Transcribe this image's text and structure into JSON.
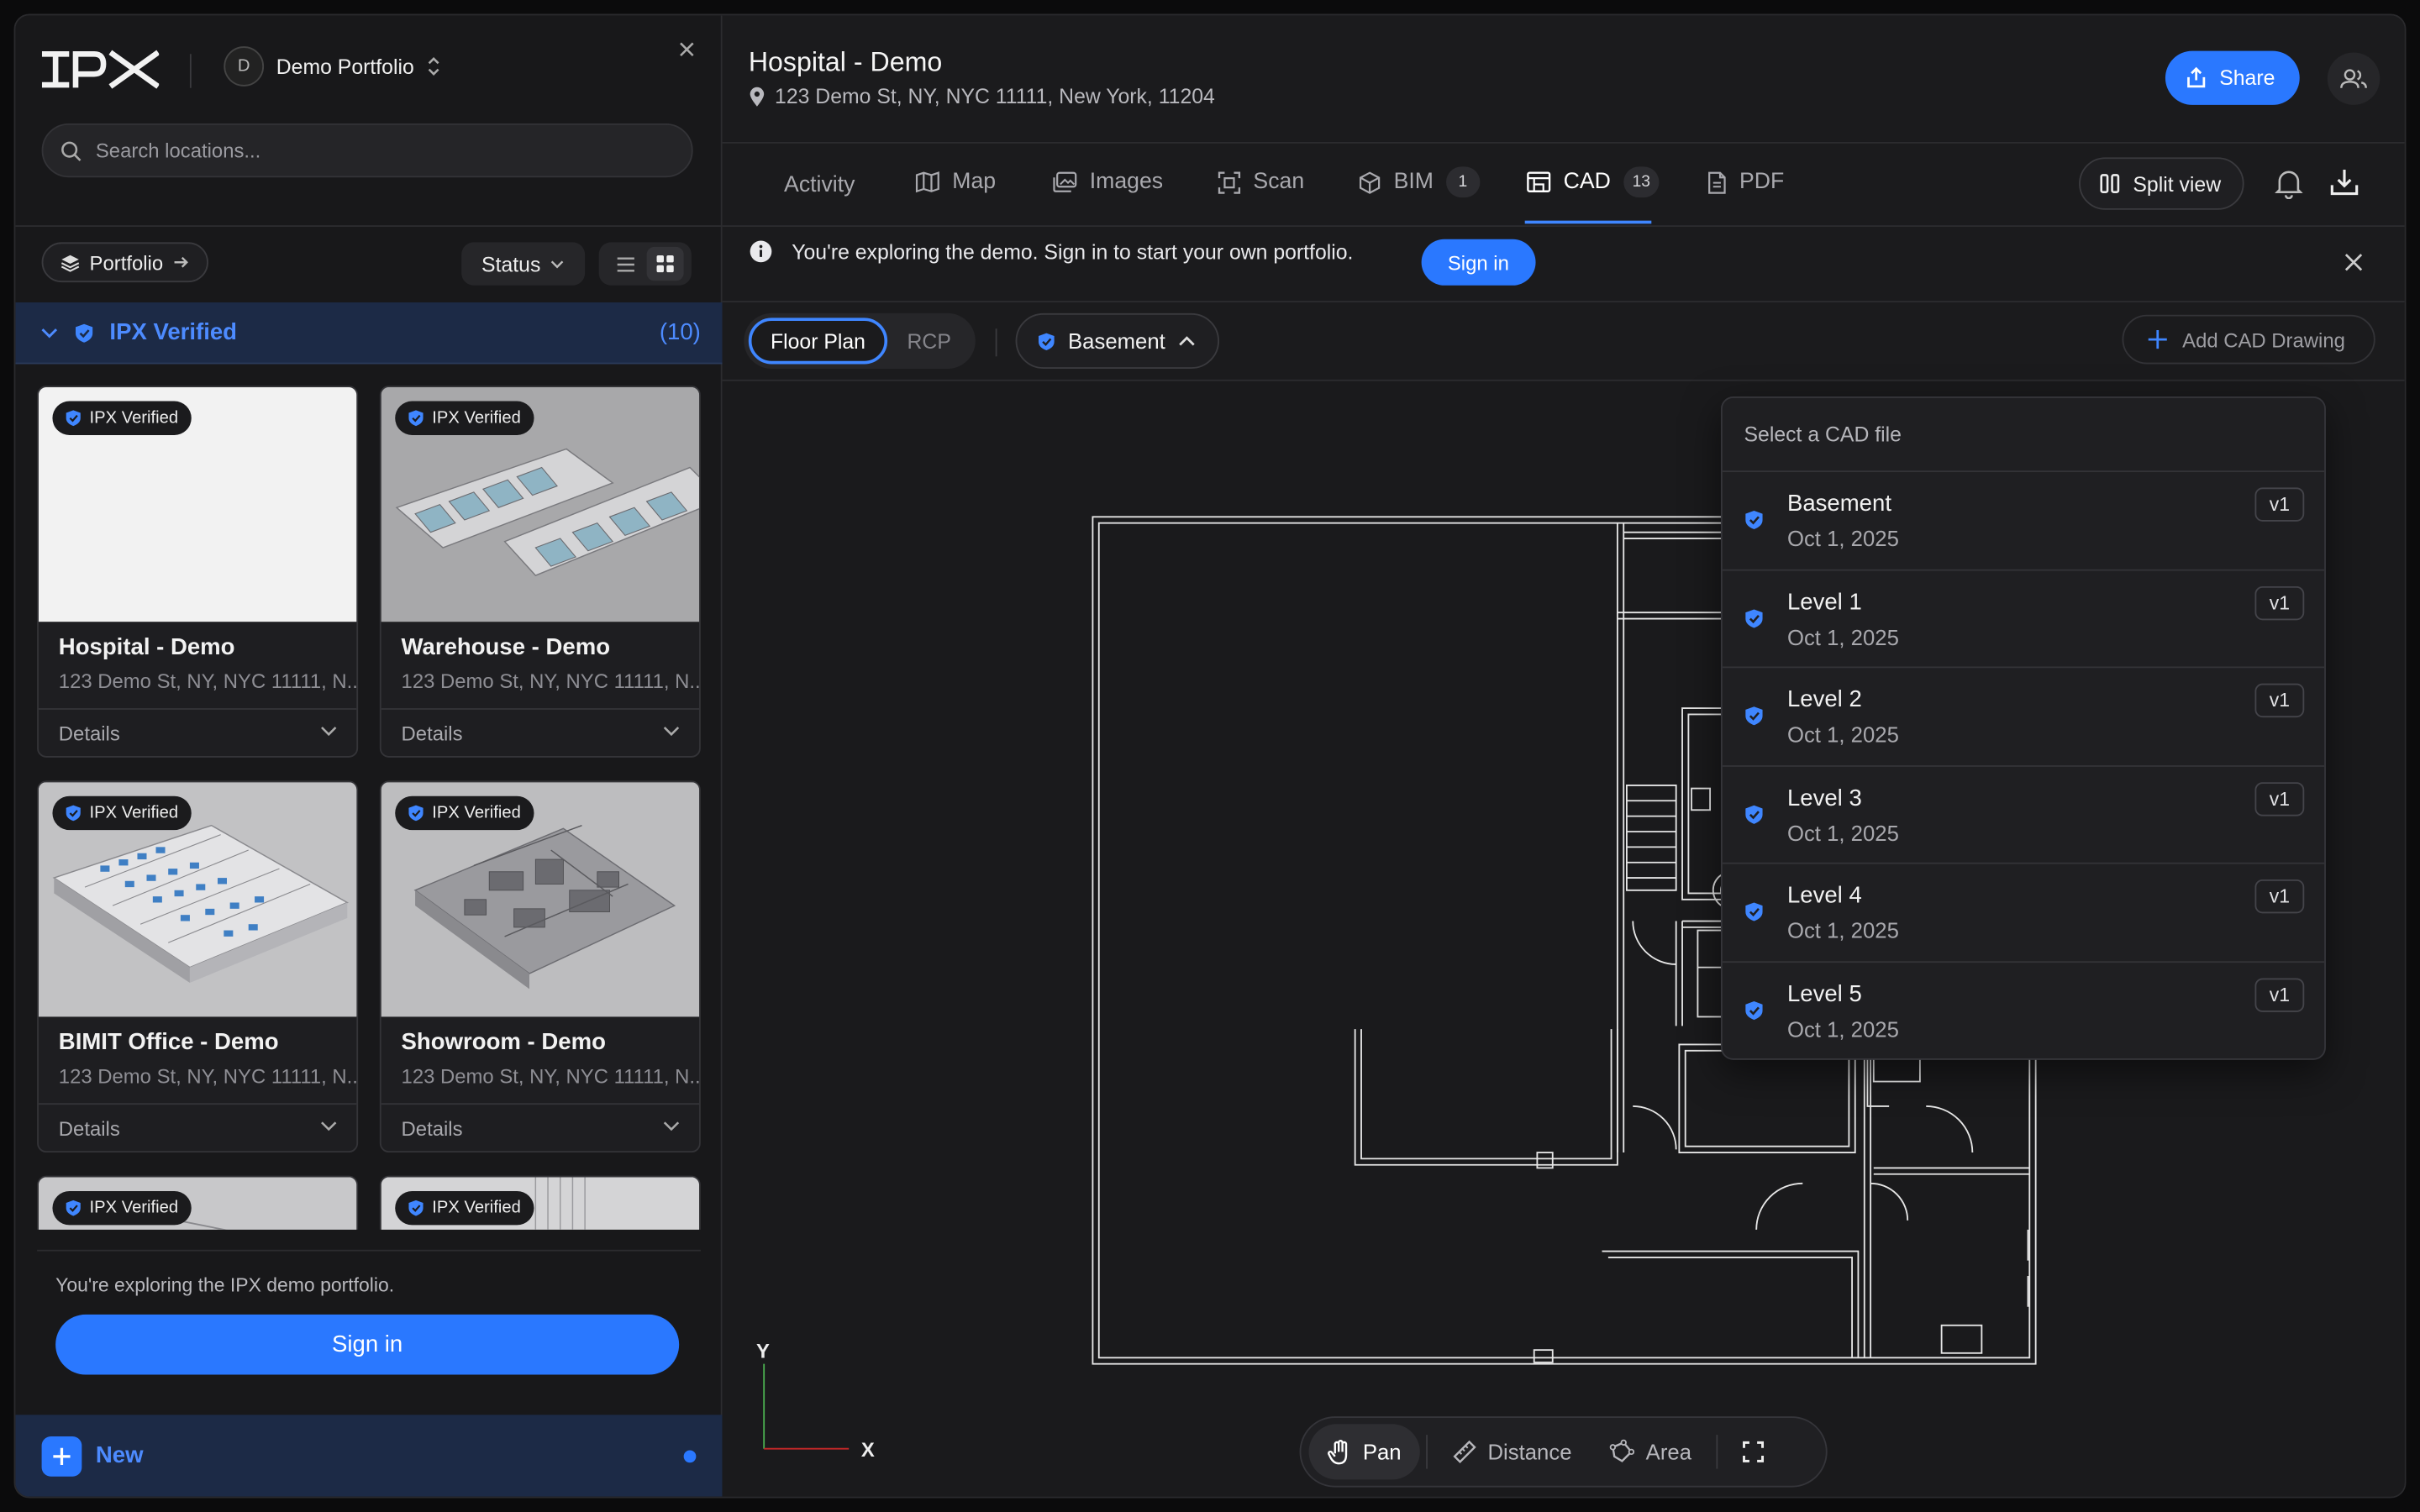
{
  "sidebar": {
    "portfolio_switcher": {
      "avatar_initial": "D",
      "name": "Demo Portfolio"
    },
    "search": {
      "placeholder": "Search locations..."
    },
    "portfolio_button": "Portfolio",
    "status_filter": "Status",
    "group": {
      "label": "IPX Verified",
      "count": "(10)"
    },
    "cards": [
      {
        "badge": "IPX Verified",
        "title": "Hospital - Demo",
        "address": "123 Demo St, NY, NYC 11111, N...",
        "details": "Details"
      },
      {
        "badge": "IPX Verified",
        "title": "Warehouse - Demo",
        "address": "123 Demo St, NY, NYC 11111, N...",
        "details": "Details"
      },
      {
        "badge": "IPX Verified",
        "title": "BIMIT Office - Demo",
        "address": "123 Demo St, NY, NYC 11111, N...",
        "details": "Details"
      },
      {
        "badge": "IPX Verified",
        "title": "Showroom - Demo",
        "address": "123 Demo St, NY, NYC 11111, N...",
        "details": "Details"
      },
      {
        "badge": "IPX Verified"
      },
      {
        "badge": "IPX Verified"
      }
    ],
    "footer_text": "You're exploring the IPX demo portfolio.",
    "signin_label": "Sign in",
    "new_label": "New"
  },
  "header": {
    "title": "Hospital - Demo",
    "address": "123 Demo St, NY, NYC 11111, New York, 11204",
    "share_label": "Share"
  },
  "tabs": [
    {
      "label": "Activity"
    },
    {
      "label": "Map",
      "icon": "map-icon"
    },
    {
      "label": "Images",
      "icon": "images-icon"
    },
    {
      "label": "Scan",
      "icon": "scan-icon"
    },
    {
      "label": "BIM",
      "icon": "cube-icon",
      "count": "1"
    },
    {
      "label": "CAD",
      "icon": "cad-icon",
      "count": "13",
      "active": true
    },
    {
      "label": "PDF",
      "icon": "pdf-icon"
    }
  ],
  "split_view_label": "Split view",
  "notice": {
    "text": "You're exploring the demo. Sign in to start your own portfolio.",
    "signin_label": "Sign in"
  },
  "controls": {
    "plan_types": [
      "Floor Plan",
      "RCP"
    ],
    "selected_level": "Basement",
    "add_cad_label": "Add CAD Drawing"
  },
  "dropdown": {
    "header": "Select a CAD file",
    "items": [
      {
        "name": "Basement",
        "date": "Oct 1, 2025",
        "version": "v1"
      },
      {
        "name": "Level 1",
        "date": "Oct 1, 2025",
        "version": "v1"
      },
      {
        "name": "Level 2",
        "date": "Oct 1, 2025",
        "version": "v1"
      },
      {
        "name": "Level 3",
        "date": "Oct 1, 2025",
        "version": "v1"
      },
      {
        "name": "Level 4",
        "date": "Oct 1, 2025",
        "version": "v1"
      },
      {
        "name": "Level 5",
        "date": "Oct 1, 2025",
        "version": "v1"
      }
    ]
  },
  "axes": {
    "x": "X",
    "y": "Y"
  },
  "tools": [
    {
      "label": "Pan",
      "icon": "hand-icon",
      "active": true
    },
    {
      "label": "Distance",
      "icon": "ruler-icon"
    },
    {
      "label": "Area",
      "icon": "area-icon"
    }
  ],
  "colors": {
    "accent": "#2a78ff",
    "accent_text": "#4d8bff",
    "background": "#1b1b1d"
  }
}
